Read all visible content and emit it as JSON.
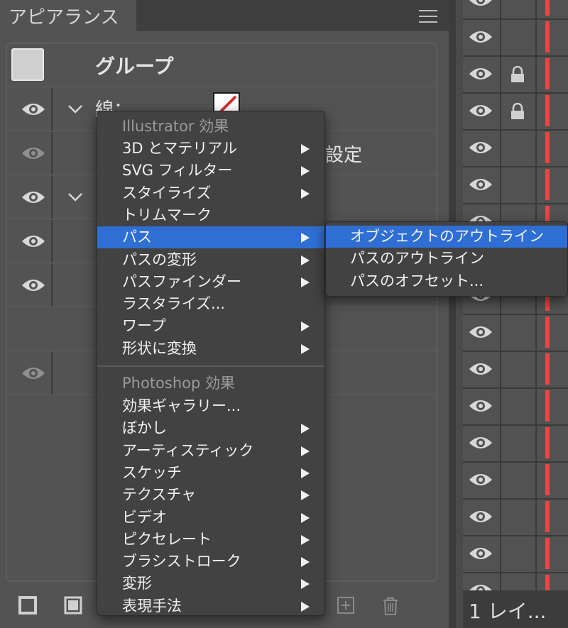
{
  "appearance_panel": {
    "tab_title": "アピアランス",
    "group_label": "グループ",
    "stroke_label": "線：",
    "partial_setting_text": "設定",
    "footer_icons": [
      "new-stroke-icon",
      "new-fill-icon",
      "add-icon",
      "trash-icon"
    ]
  },
  "effects_menu": {
    "illustrator_header": "Illustrator 効果",
    "illustrator_items": [
      {
        "label": "3D とマテリアル",
        "submenu": true
      },
      {
        "label": "SVG フィルター",
        "submenu": true
      },
      {
        "label": "スタイライズ",
        "submenu": true
      },
      {
        "label": "トリムマーク",
        "submenu": false
      },
      {
        "label": "パス",
        "submenu": true,
        "selected": true
      },
      {
        "label": "パスの変形",
        "submenu": true
      },
      {
        "label": "パスファインダー",
        "submenu": true
      },
      {
        "label": "ラスタライズ...",
        "submenu": false
      },
      {
        "label": "ワープ",
        "submenu": true
      },
      {
        "label": "形状に変換",
        "submenu": true
      }
    ],
    "photoshop_header": "Photoshop 効果",
    "photoshop_items": [
      {
        "label": "効果ギャラリー...",
        "submenu": false
      },
      {
        "label": "ぼかし",
        "submenu": true
      },
      {
        "label": "アーティスティック",
        "submenu": true
      },
      {
        "label": "スケッチ",
        "submenu": true
      },
      {
        "label": "テクスチャ",
        "submenu": true
      },
      {
        "label": "ビデオ",
        "submenu": true
      },
      {
        "label": "ピクセレート",
        "submenu": true
      },
      {
        "label": "ブラシストローク",
        "submenu": true
      },
      {
        "label": "変形",
        "submenu": true
      },
      {
        "label": "表現手法",
        "submenu": true
      }
    ]
  },
  "path_submenu": {
    "items": [
      {
        "label": "オブジェクトのアウトライン",
        "selected": true
      },
      {
        "label": "パスのアウトライン",
        "selected": false
      },
      {
        "label": "パスのオフセット...",
        "selected": false
      }
    ]
  },
  "layers_panel": {
    "count_label": "1 レイ..."
  },
  "colors": {
    "selection_blue": "#2f6fd4",
    "layer_color_red": "#ef4444",
    "panel_bg": "#535353"
  }
}
